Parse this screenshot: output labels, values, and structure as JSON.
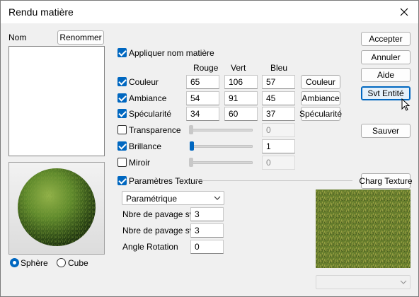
{
  "window": {
    "title": "Rendu matière",
    "close_label": "✕"
  },
  "nom": {
    "label": "Nom",
    "rename_button": "Renommer"
  },
  "apply_name": {
    "label": "Appliquer nom matière",
    "checked": true
  },
  "columns": {
    "rouge": "Rouge",
    "vert": "Vert",
    "bleu": "Bleu"
  },
  "rows": {
    "couleur": {
      "label": "Couleur",
      "checked": true,
      "r": "65",
      "g": "106",
      "b": "57",
      "button": "Couleur"
    },
    "ambiance": {
      "label": "Ambiance",
      "checked": true,
      "r": "54",
      "g": "91",
      "b": "45",
      "button": "Ambiance"
    },
    "specularite": {
      "label": "Spécularité",
      "checked": true,
      "r": "34",
      "g": "60",
      "b": "37",
      "button": "Spécularité"
    },
    "transparence": {
      "label": "Transparence",
      "checked": false,
      "value": "0",
      "level": 0
    },
    "brillance": {
      "label": "Brillance",
      "checked": true,
      "value": "1",
      "level": 0.01
    },
    "miroir": {
      "label": "Miroir",
      "checked": false,
      "value": "0",
      "level": 0
    }
  },
  "texture": {
    "label": "Paramètres Texture",
    "checked": true,
    "load_button": "Charg Texture",
    "mapping_select": "Paramétrique",
    "fields": [
      {
        "label": "Nbre de pavage svt",
        "value": "3"
      },
      {
        "label": "Nbre de pavage svt",
        "value": "3"
      },
      {
        "label": "Angle Rotation",
        "value": "0"
      }
    ],
    "bottom_select": ""
  },
  "preview": {
    "shape_options": [
      {
        "label": "Sphère",
        "selected": true
      },
      {
        "label": "Cube",
        "selected": false
      }
    ]
  },
  "actions": {
    "accepter": "Accepter",
    "annuler": "Annuler",
    "aide": "Aide",
    "svt_entite": "Svt Entité",
    "sauver": "Sauver"
  },
  "colors": {
    "accent": "#0067c0",
    "material": "#416a39"
  }
}
